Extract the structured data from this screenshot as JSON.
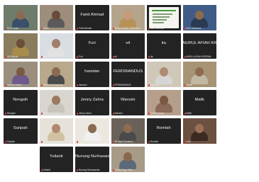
{
  "tiles": [
    {
      "display": "",
      "name": "Ryo Lestari",
      "scene": "video",
      "bg": "#6f7c6a",
      "skin": "#8a6a52",
      "shirt": "#3b4f6a"
    },
    {
      "display": "",
      "name": "Nazril",
      "scene": "video",
      "bg": "#9c8e7a",
      "skin": "#6a4b38",
      "shirt": "#5a5a5a"
    },
    {
      "display": "Farid Ahmad",
      "name": "Farid Ahmad",
      "scene": "name"
    },
    {
      "display": "",
      "name": "Wahyuningsih, Sukmarita",
      "scene": "video",
      "bg": "#b4a48c",
      "skin": "#c79a7c",
      "shirt": "#b79257"
    },
    {
      "display": "",
      "name": "Mira Harnanti",
      "scene": "slide"
    },
    {
      "display": "",
      "name": "Arie Oktaviana",
      "scene": "video",
      "bg": "#3f5c86",
      "skin": "#8c6a4c",
      "shirt": "#2a3a52"
    },
    {
      "display": "",
      "name": "",
      "scene": "empty"
    },
    {
      "display": "",
      "name": "Siti Bapola",
      "scene": "video",
      "bg": "#8a7d5e",
      "skin": "#6c4f3a",
      "shirt": "#a88d4a"
    },
    {
      "display": "",
      "name": "Widiawti Suhartas",
      "scene": "video",
      "bg": "#d8dde2",
      "skin": "#a0806a",
      "shirt": "#e2e2e2"
    },
    {
      "display": "Furi",
      "name": "Furi",
      "scene": "name"
    },
    {
      "display": "eli",
      "name": "eli",
      "scene": "name"
    },
    {
      "display": "ita",
      "name": "ita",
      "scene": "name"
    },
    {
      "display": "NURUL AFIAH KRE",
      "name": "NURUL AFIAH KRESNA",
      "scene": "name"
    },
    {
      "display": "",
      "name": "",
      "scene": "empty"
    },
    {
      "display": "",
      "name": "Yahrotul Saleh",
      "scene": "video",
      "bg": "#9a8f7c",
      "skin": "#7a5a44",
      "shirt": "#6e5a8e"
    },
    {
      "display": "",
      "name": "Wulp Ari Kesadiang",
      "scene": "video",
      "bg": "#b8a88c",
      "skin": "#8c6a50",
      "shirt": "#4a4a4a"
    },
    {
      "display": "hamdan",
      "name": "hamdan",
      "scene": "name"
    },
    {
      "display": "FERDINANDUS",
      "name": "FERDINANDUS",
      "scene": "name"
    },
    {
      "display": "",
      "name": "Dwiji Nofi",
      "scene": "video",
      "bg": "#cfc8b8",
      "skin": "#b08a70",
      "shirt": "#d5d5d5"
    },
    {
      "display": "",
      "name": "Melati",
      "scene": "video",
      "bg": "#a79474",
      "skin": "#8e6a52",
      "shirt": "#c3b8a4"
    },
    {
      "display": "",
      "name": "",
      "scene": "empty"
    },
    {
      "display": "Nengsih",
      "name": "Nengsih",
      "scene": "name"
    },
    {
      "display": "",
      "name": "Syafrudin Lopet",
      "scene": "video",
      "bg": "#d9d6cf",
      "skin": "#9c7a62",
      "shirt": "#c8c4bc"
    },
    {
      "display": "Jenny Zahra",
      "name": "Jenny Zahra",
      "scene": "name"
    },
    {
      "display": "Wansini",
      "name": "Wansini",
      "scene": "name"
    },
    {
      "display": "",
      "name": "Mulatiq Anjem",
      "scene": "video",
      "bg": "#b59f8a",
      "skin": "#7a5844",
      "shirt": "#8a6a58"
    },
    {
      "display": "Malik",
      "name": "Malik",
      "scene": "name"
    },
    {
      "display": "",
      "name": "",
      "scene": "empty"
    },
    {
      "display": "Saripah",
      "name": "Saripah",
      "scene": "name"
    },
    {
      "display": "",
      "name": "Gaba Anggraini_2020520000",
      "scene": "video",
      "bg": "#e6e2da",
      "skin": "#b08a6e",
      "shirt": "#d2c2a2"
    },
    {
      "display": "",
      "name": "Ayu Anggita",
      "scene": "video",
      "bg": "#ece8e0",
      "skin": "#8a6a52",
      "shirt": "#f0f0f0"
    },
    {
      "display": "",
      "name": "Bli Agus Purnama",
      "scene": "video",
      "bg": "#6a6258",
      "skin": "#8c6c54",
      "shirt": "#4a4a4a"
    },
    {
      "display": "Romlah",
      "name": "Romlah",
      "scene": "name"
    },
    {
      "display": "",
      "name": "Lisa",
      "scene": "video",
      "bg": "#6c5040",
      "skin": "#9a7058",
      "shirt": "#3a2a22"
    },
    {
      "display": "",
      "name": "",
      "scene": "empty"
    },
    {
      "display": "",
      "name": "",
      "scene": "empty"
    },
    {
      "display": "Yulianti",
      "name": "Yulianti",
      "scene": "name"
    },
    {
      "display": "Nunung Nurhasanah",
      "name": "Nunung Nurhasanah",
      "scene": "name"
    },
    {
      "display": "",
      "name": "Suhaji Wayu Mitra",
      "scene": "video",
      "bg": "#a79a86",
      "skin": "#8a6850",
      "shirt": "#5a6a7a"
    },
    {
      "display": "",
      "name": "",
      "scene": "empty"
    },
    {
      "display": "",
      "name": "",
      "scene": "empty"
    },
    {
      "display": "",
      "name": "",
      "scene": "empty"
    }
  ]
}
